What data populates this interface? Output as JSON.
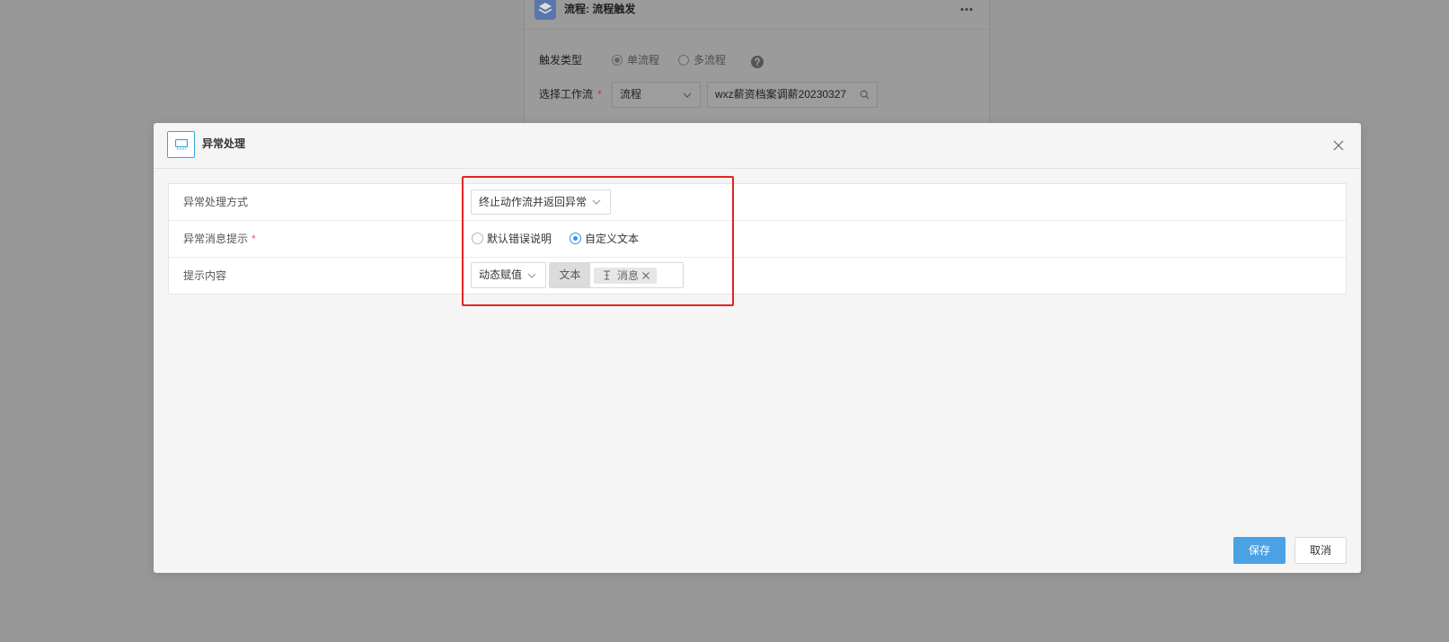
{
  "background_panel": {
    "app_icon": "layers-icon",
    "title": "流程: 流程触发",
    "more_icon": "more-icon",
    "trigger_type": {
      "label": "触发类型",
      "options": [
        {
          "label": "单流程",
          "checked": true
        },
        {
          "label": "多流程",
          "checked": false
        }
      ],
      "help_icon": "help-icon"
    },
    "workflow": {
      "label": "选择工作流",
      "required_mark": "*",
      "type_select": {
        "value": "流程",
        "icon": "chevron-down-icon"
      },
      "search": {
        "value": "wxz薪资档案调薪20230327",
        "icon": "search-icon"
      }
    }
  },
  "modal": {
    "icon": "monitor-icon",
    "title": "异常处理",
    "close_icon": "close-icon",
    "rows": [
      {
        "label": "异常处理方式",
        "select": {
          "value": "终止动作流并返回异常",
          "icon": "chevron-down-icon"
        }
      },
      {
        "label": "异常消息提示",
        "required_mark": "*",
        "options": [
          {
            "label": "默认错误说明",
            "checked": false
          },
          {
            "label": "自定义文本",
            "checked": true
          }
        ]
      },
      {
        "label": "提示内容",
        "select": {
          "value": "动态赋值",
          "icon": "chevron-down-icon"
        },
        "value_type": "文本",
        "tag": {
          "icon": "text-cursor-icon",
          "label": "消息",
          "remove_icon": "close-icon"
        }
      }
    ],
    "footer": {
      "save_label": "保存",
      "cancel_label": "取消"
    }
  },
  "colors": {
    "accent": "#3a8ee6",
    "primary_button": "#4aa2e4",
    "required": "#e85b5b",
    "highlight_box": "#e0251f",
    "icon_border": "#35a7dd"
  }
}
